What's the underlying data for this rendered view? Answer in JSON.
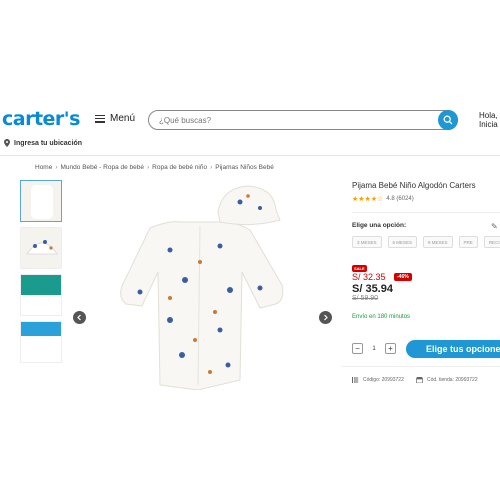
{
  "header": {
    "logo": "carter's",
    "menu_label": "Menú",
    "search_placeholder": "¿Qué buscas?",
    "greeting_line1": "Hola,",
    "greeting_line2": "Inicia",
    "location_label": "Ingresa tu ubicación"
  },
  "breadcrumb": [
    "Home",
    "Mundo Bebé - Ropa de bebé",
    "Ropa de bebé niño",
    "Pijamas Niños Bebé"
  ],
  "product": {
    "title": "Pijama Bebé Niño Algodón Carters",
    "rating": 4.5,
    "rating_text": "4.8 (6024)",
    "option_label": "Elige una opción:",
    "sizes": [
      "3 MESES",
      "6 MESES",
      "9 MESES",
      "PRE",
      "RECIÉN N"
    ],
    "sale_tag": "SALE",
    "price_old_red": "S/ 32.35",
    "discount": "-46%",
    "price_main": "S/ 35.94",
    "price_strike": "S/ 59.90",
    "shipping": "Envío en 180 minutos",
    "quantity": "1",
    "buy_label": "Elige tus opciones",
    "code_label": "Código: 20993722",
    "store_code_label": "Cód. tienda: 20993722"
  },
  "colors": {
    "brand": "#0a8ad6",
    "accent": "#1f97d4",
    "sale": "#d40000",
    "shipping": "#1d9a3a"
  },
  "icons": [
    "hamburger-icon",
    "search-icon",
    "location-pin-icon",
    "share-icon",
    "pencil-icon",
    "chevron-left-icon",
    "chevron-right-icon",
    "barcode-icon",
    "store-icon"
  ]
}
